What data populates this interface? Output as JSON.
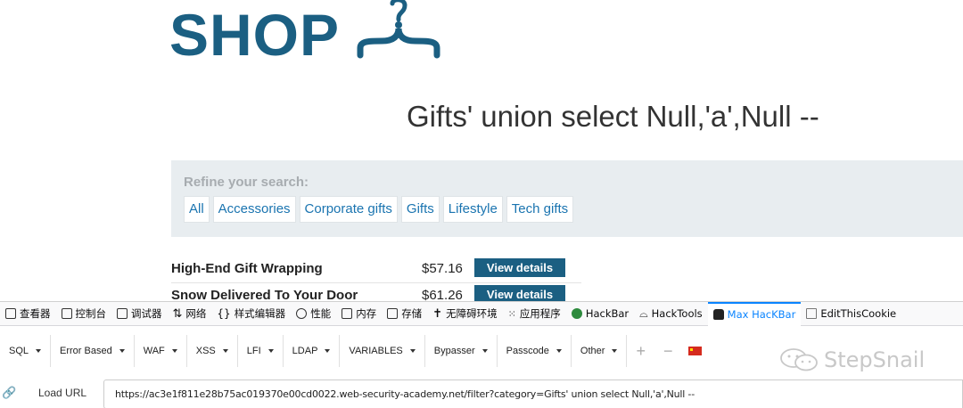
{
  "logo": {
    "text": "SHOP"
  },
  "page": {
    "title": "Gifts' union select Null,'a',Null --"
  },
  "refine": {
    "label": "Refine your search:",
    "filters": [
      "All",
      "Accessories",
      "Corporate gifts",
      "Gifts",
      "Lifestyle",
      "Tech gifts"
    ]
  },
  "products": [
    {
      "name": "High-End Gift Wrapping",
      "price": "$57.16",
      "button": "View details"
    },
    {
      "name": "Snow Delivered To Your Door",
      "price": "$61.26",
      "button": "View details"
    }
  ],
  "devtools": {
    "tabs": [
      "查看器",
      "控制台",
      "调试器",
      "网络",
      "样式编辑器",
      "性能",
      "内存",
      "存储",
      "无障碍环境",
      "应用程序",
      "HackBar",
      "HackTools",
      "Max HacKBar",
      "EditThisCookie"
    ],
    "active_tab": "Max HacKBar",
    "hackbar_menus": [
      "SQL",
      "Error Based",
      "WAF",
      "XSS",
      "LFI",
      "LDAP",
      "VARIABLES",
      "Bypasser",
      "Passcode",
      "Other"
    ],
    "load_url_label": "Load URL",
    "url": "https://ac3e1f811e28b75ac019370e00cd0022.web-security-academy.net/filter?category=Gifts' union select Null,'a',Null --"
  },
  "watermark": {
    "text": "StepSnail"
  },
  "colors": {
    "brand": "#1b5f82",
    "link": "#1a74b0",
    "panel": "#e8edf0",
    "active_tab": "#0a84ff"
  }
}
